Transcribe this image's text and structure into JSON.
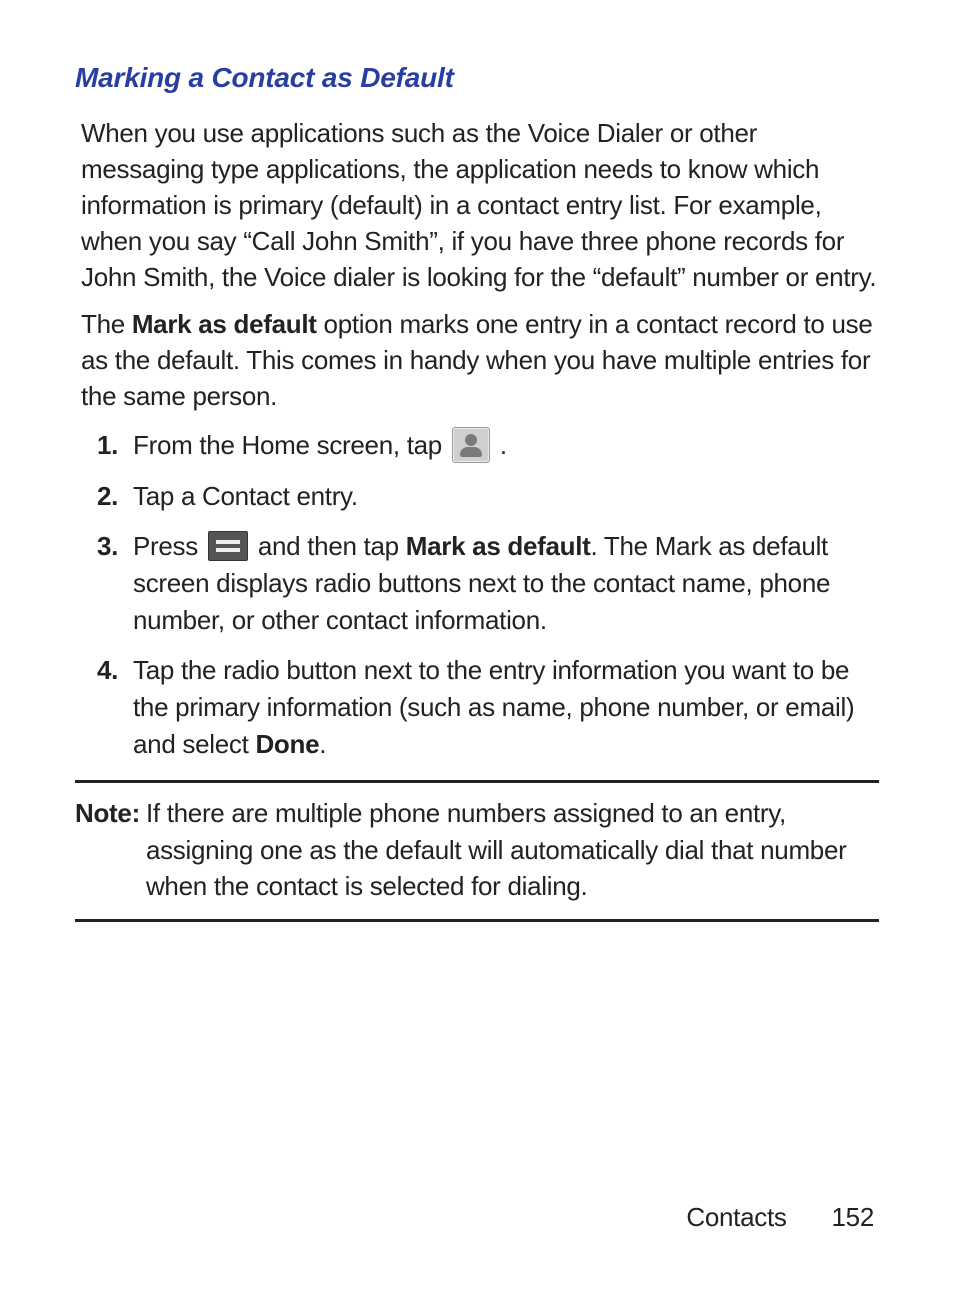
{
  "title": "Marking a Contact as Default",
  "para1": "When you use applications such as the Voice Dialer or other messaging type applications, the application needs to know which information is primary (default) in a contact entry list. For example, when you say “Call John Smith”, if you have three phone records for John Smith, the Voice dialer is looking for the “default” number or entry.",
  "para2_pre": "The ",
  "para2_bold": "Mark as default",
  "para2_post": " option marks one entry in a contact record to use as the default. This comes in handy when you have multiple entries for the same person.",
  "steps": {
    "s1_num": "1.",
    "s1_a": "From the Home screen, tap ",
    "s1_b": ".",
    "s2_num": "2.",
    "s2": "Tap a Contact entry.",
    "s3_num": "3.",
    "s3_a": "Press ",
    "s3_b": " and then tap ",
    "s3_bold": "Mark as default",
    "s3_c": ". The Mark as default screen displays radio buttons next to the contact name, phone number, or other contact information.",
    "s4_num": "4.",
    "s4_a": "Tap the radio button next to the entry information you want to be the primary information (such as name, phone number, or email) and select ",
    "s4_bold": "Done",
    "s4_b": "."
  },
  "note": {
    "label": "Note:",
    "text": "If there are multiple phone numbers assigned to an entry, assigning one as the default will automatically dial that number when the contact is selected for dialing."
  },
  "footer": {
    "section": "Contacts",
    "page": "152"
  }
}
